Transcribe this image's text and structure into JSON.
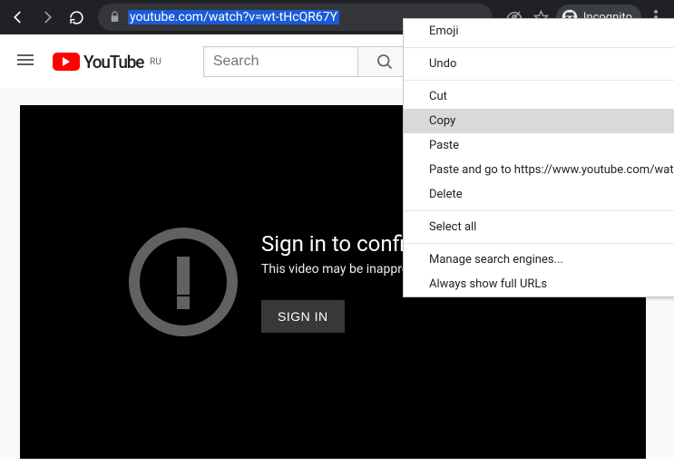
{
  "browser": {
    "url": "youtube.com/watch?v=wt-tHcQR67Y",
    "incognito_label": "Incognito"
  },
  "youtube": {
    "logo_text": "YouTube",
    "region": "RU",
    "search_placeholder": "Search"
  },
  "player": {
    "title": "Sign in to confirm your age",
    "subtitle": "This video may be inappropriate for some users.",
    "button": "SIGN IN"
  },
  "context_menu": {
    "items": [
      {
        "label": "Emoji",
        "type": "item"
      },
      {
        "type": "sep"
      },
      {
        "label": "Undo",
        "type": "item"
      },
      {
        "type": "sep"
      },
      {
        "label": "Cut",
        "type": "item"
      },
      {
        "label": "Copy",
        "type": "item",
        "hover": true
      },
      {
        "label": "Paste",
        "type": "item"
      },
      {
        "label": "Paste and go to https://www.youtube.com/watch?v",
        "type": "item"
      },
      {
        "label": "Delete",
        "type": "item"
      },
      {
        "type": "sep"
      },
      {
        "label": "Select all",
        "type": "item"
      },
      {
        "type": "sep"
      },
      {
        "label": "Manage search engines...",
        "type": "item"
      },
      {
        "label": "Always show full URLs",
        "type": "item"
      }
    ]
  }
}
